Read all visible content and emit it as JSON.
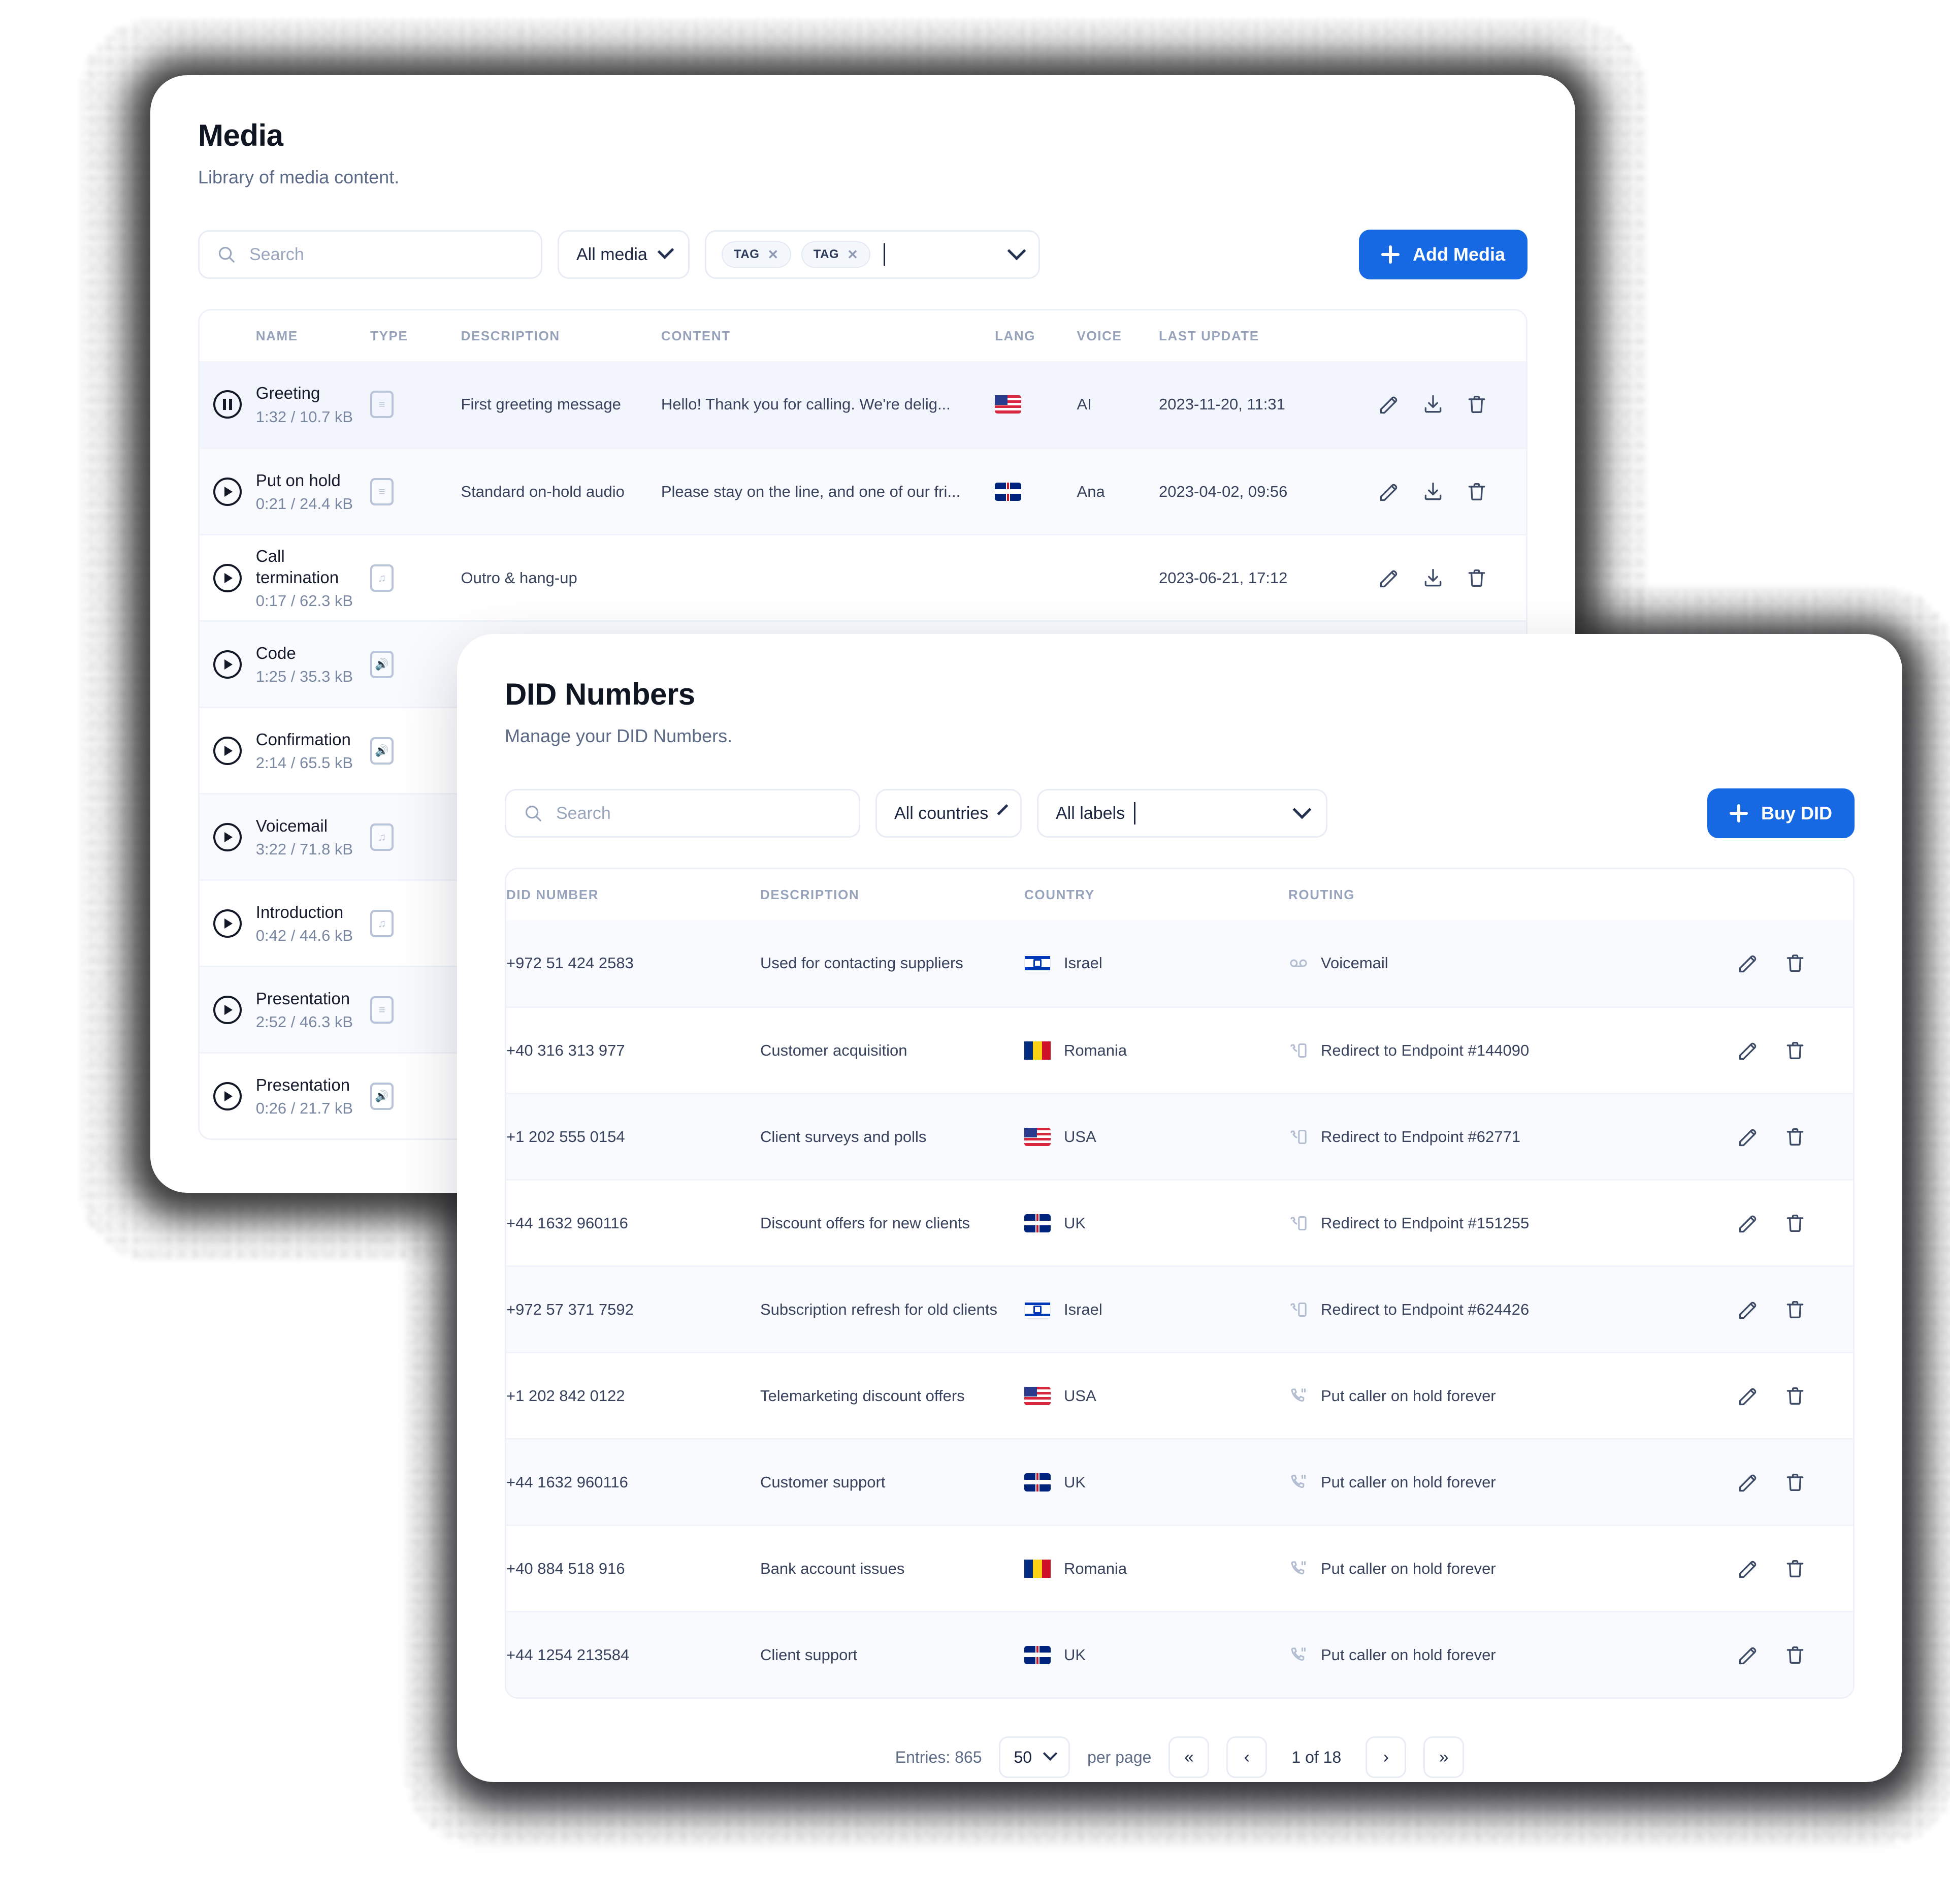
{
  "media_panel": {
    "title": "Media",
    "subtitle": "Library of media content.",
    "search_placeholder": "Search",
    "type_filter": "All media",
    "tags": [
      "TAG",
      "TAG"
    ],
    "add_button": "Add Media",
    "columns": [
      "NAME",
      "TYPE",
      "DESCRIPTION",
      "CONTENT",
      "LANG",
      "VOICE",
      "LAST UPDATE"
    ],
    "rows": [
      {
        "name": "Greeting",
        "meta": "1:32 / 10.7 kB",
        "state": "pause",
        "type_icon": "tts-document-icon",
        "description": "First greeting message",
        "content": "Hello! Thank you for calling. We're delig...",
        "lang": "us",
        "voice": "AI",
        "last_update": "2023-11-20, 11:31"
      },
      {
        "name": "Put on hold",
        "meta": "0:21 / 24.4 kB",
        "state": "play",
        "type_icon": "tts-document-icon",
        "description": "Standard on-hold audio",
        "content": "Please stay on the line, and one of our fri...",
        "lang": "uk",
        "voice": "Ana",
        "last_update": "2023-04-02, 09:56"
      },
      {
        "name": "Call termination",
        "meta": "0:17 / 62.3 kB",
        "state": "play",
        "type_icon": "music-icon",
        "description": "Outro & hang-up",
        "content": "",
        "lang": "",
        "voice": "",
        "last_update": "2023-06-21, 17:12"
      },
      {
        "name": "Code",
        "meta": "1:25 / 35.3 kB",
        "state": "play",
        "type_icon": "speaker-icon",
        "description": "",
        "content": "",
        "lang": "",
        "voice": "",
        "last_update": ""
      },
      {
        "name": "Confirmation",
        "meta": "2:14 / 65.5 kB",
        "state": "play",
        "type_icon": "speaker-icon",
        "description": "",
        "content": "",
        "lang": "",
        "voice": "",
        "last_update": ""
      },
      {
        "name": "Voicemail",
        "meta": "3:22 / 71.8 kB",
        "state": "play",
        "type_icon": "music-icon",
        "description": "",
        "content": "",
        "lang": "",
        "voice": "",
        "last_update": ""
      },
      {
        "name": "Introduction",
        "meta": "0:42 / 44.6 kB",
        "state": "play",
        "type_icon": "music-icon",
        "description": "",
        "content": "",
        "lang": "",
        "voice": "",
        "last_update": ""
      },
      {
        "name": "Presentation",
        "meta": "2:52 / 46.3 kB",
        "state": "play",
        "type_icon": "tts-document-icon",
        "description": "",
        "content": "",
        "lang": "",
        "voice": "",
        "last_update": ""
      },
      {
        "name": "Presentation",
        "meta": "0:26 / 21.7 kB",
        "state": "play",
        "type_icon": "speaker-icon",
        "description": "",
        "content": "",
        "lang": "",
        "voice": "",
        "last_update": ""
      }
    ]
  },
  "did_panel": {
    "title": "DID Numbers",
    "subtitle": "Manage your DID Numbers.",
    "search_placeholder": "Search",
    "country_filter": "All countries",
    "label_filter": "All labels",
    "buy_button": "Buy DID",
    "columns": [
      "DID NUMBER",
      "DESCRIPTION",
      "COUNTRY",
      "ROUTING"
    ],
    "rows": [
      {
        "number": "+972 51 424 2583",
        "description": "Used for contacting suppliers",
        "country": "Israel",
        "flag": "il",
        "routing": "Voicemail",
        "routing_icon": "voicemail-icon"
      },
      {
        "number": "+40 316 313 977",
        "description": "Customer acquisition",
        "country": "Romania",
        "flag": "ro",
        "routing": "Redirect to Endpoint #144090",
        "routing_icon": "endpoint-icon"
      },
      {
        "number": "+1 202 555 0154",
        "description": "Client surveys and polls",
        "country": "USA",
        "flag": "us",
        "routing": "Redirect to Endpoint #62771",
        "routing_icon": "endpoint-icon"
      },
      {
        "number": "+44 1632 960116",
        "description": "Discount offers for new clients",
        "country": "UK",
        "flag": "uk",
        "routing": "Redirect to Endpoint #151255",
        "routing_icon": "endpoint-icon"
      },
      {
        "number": "+972 57 371 7592",
        "description": "Subscription refresh for old clients",
        "country": "Israel",
        "flag": "il",
        "routing": "Redirect to Endpoint #624426",
        "routing_icon": "endpoint-icon"
      },
      {
        "number": "+1 202 842 0122",
        "description": "Telemarketing discount offers",
        "country": "USA",
        "flag": "us",
        "routing": "Put caller on hold forever",
        "routing_icon": "phone-hold-icon"
      },
      {
        "number": "+44 1632 960116",
        "description": "Customer support",
        "country": "UK",
        "flag": "uk",
        "routing": "Put caller on hold forever",
        "routing_icon": "phone-hold-icon"
      },
      {
        "number": "+40 884 518 916",
        "description": "Bank account issues",
        "country": "Romania",
        "flag": "ro",
        "routing": "Put caller on hold forever",
        "routing_icon": "phone-hold-icon"
      },
      {
        "number": "+44 1254 213584",
        "description": "Client support",
        "country": "UK",
        "flag": "uk",
        "routing": "Put caller on hold forever",
        "routing_icon": "phone-hold-icon"
      }
    ],
    "pagination": {
      "entries": "Entries: 865",
      "per_page_value": "50",
      "per_page_label": "per page",
      "position": "1 of 18",
      "first": "«",
      "prev": "‹",
      "next": "›",
      "last": "»"
    }
  },
  "colors": {
    "accent": "#1668e3",
    "text": "#151b2c",
    "muted": "#7b88a2",
    "border": "#e7ecf5"
  }
}
